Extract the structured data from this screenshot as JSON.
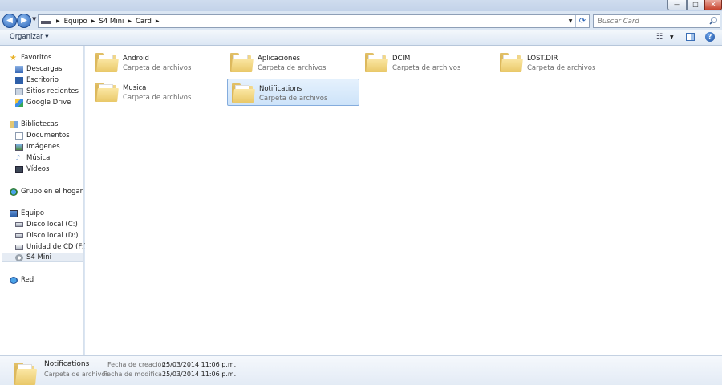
{
  "window": {
    "min_glyph": "—",
    "max_glyph": "□",
    "close_glyph": "✕"
  },
  "address": {
    "breadcrumbs": [
      "Equipo",
      "S4 Mini",
      "Card"
    ]
  },
  "search": {
    "placeholder": "Buscar Card"
  },
  "toolbar": {
    "organize_label": "Organizar ▾",
    "help_glyph": "?"
  },
  "sidebar": {
    "favorites": {
      "label": "Favoritos",
      "icon": "star-icon",
      "items": [
        {
          "label": "Descargas",
          "icon": "downloads-icon"
        },
        {
          "label": "Escritorio",
          "icon": "desktop-icon"
        },
        {
          "label": "Sitios recientes",
          "icon": "recent-places-icon"
        },
        {
          "label": "Google Drive",
          "icon": "google-drive-icon"
        }
      ]
    },
    "libraries": {
      "label": "Bibliotecas",
      "icon": "libraries-icon",
      "items": [
        {
          "label": "Documentos",
          "icon": "documents-icon"
        },
        {
          "label": "Imágenes",
          "icon": "pictures-icon"
        },
        {
          "label": "Música",
          "icon": "music-icon"
        },
        {
          "label": "Vídeos",
          "icon": "videos-icon"
        }
      ]
    },
    "homegroup": {
      "label": "Grupo en el hogar",
      "icon": "homegroup-icon"
    },
    "computer": {
      "label": "Equipo",
      "icon": "computer-icon",
      "items": [
        {
          "label": "Disco local (C:)",
          "icon": "disk-icon"
        },
        {
          "label": "Disco local (D:)",
          "icon": "disk-icon"
        },
        {
          "label": "Unidad de CD (F:)",
          "icon": "cd-drive-icon"
        },
        {
          "label": "S4 Mini",
          "icon": "phone-icon",
          "selected": true
        }
      ]
    },
    "network": {
      "label": "Red",
      "icon": "network-icon"
    }
  },
  "folders": [
    {
      "name": "Android",
      "type": "Carpeta de archivos"
    },
    {
      "name": "Aplicaciones",
      "type": "Carpeta de archivos"
    },
    {
      "name": "DCIM",
      "type": "Carpeta de archivos"
    },
    {
      "name": "LOST.DIR",
      "type": "Carpeta de archivos"
    },
    {
      "name": "Musica",
      "type": "Carpeta de archivos"
    },
    {
      "name": "Notifications",
      "type": "Carpeta de archivos",
      "selected": true
    }
  ],
  "details": {
    "name": "Notifications",
    "type": "Carpeta de archivos",
    "created_label": "Fecha de creación:",
    "created_value": "25/03/2014 11:06 p.m.",
    "modified_label": "Fecha de modifica...",
    "modified_value": "25/03/2014 11:06 p.m."
  },
  "colors": {
    "selection": "#cde3f9",
    "selection_border": "#84acdd",
    "chrome": "#dbe6f3"
  }
}
